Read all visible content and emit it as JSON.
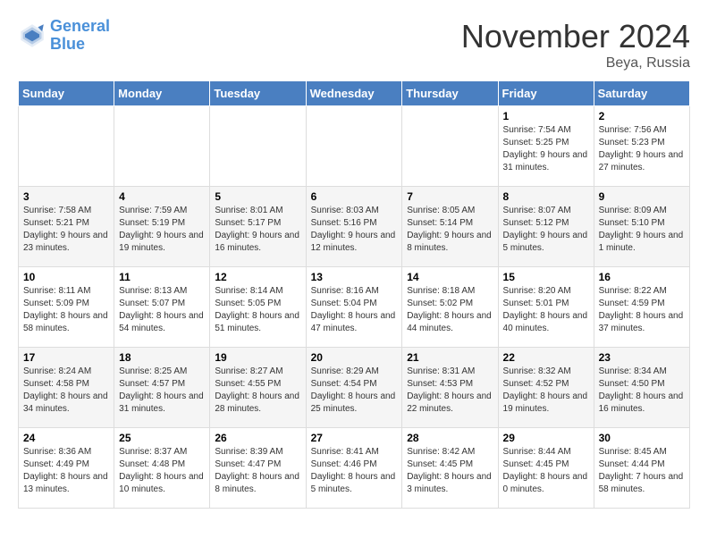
{
  "logo": {
    "line1": "General",
    "line2": "Blue"
  },
  "title": "November 2024",
  "location": "Beya, Russia",
  "days_header": [
    "Sunday",
    "Monday",
    "Tuesday",
    "Wednesday",
    "Thursday",
    "Friday",
    "Saturday"
  ],
  "weeks": [
    [
      {
        "day": "",
        "info": ""
      },
      {
        "day": "",
        "info": ""
      },
      {
        "day": "",
        "info": ""
      },
      {
        "day": "",
        "info": ""
      },
      {
        "day": "",
        "info": ""
      },
      {
        "day": "1",
        "info": "Sunrise: 7:54 AM\nSunset: 5:25 PM\nDaylight: 9 hours and 31 minutes."
      },
      {
        "day": "2",
        "info": "Sunrise: 7:56 AM\nSunset: 5:23 PM\nDaylight: 9 hours and 27 minutes."
      }
    ],
    [
      {
        "day": "3",
        "info": "Sunrise: 7:58 AM\nSunset: 5:21 PM\nDaylight: 9 hours and 23 minutes."
      },
      {
        "day": "4",
        "info": "Sunrise: 7:59 AM\nSunset: 5:19 PM\nDaylight: 9 hours and 19 minutes."
      },
      {
        "day": "5",
        "info": "Sunrise: 8:01 AM\nSunset: 5:17 PM\nDaylight: 9 hours and 16 minutes."
      },
      {
        "day": "6",
        "info": "Sunrise: 8:03 AM\nSunset: 5:16 PM\nDaylight: 9 hours and 12 minutes."
      },
      {
        "day": "7",
        "info": "Sunrise: 8:05 AM\nSunset: 5:14 PM\nDaylight: 9 hours and 8 minutes."
      },
      {
        "day": "8",
        "info": "Sunrise: 8:07 AM\nSunset: 5:12 PM\nDaylight: 9 hours and 5 minutes."
      },
      {
        "day": "9",
        "info": "Sunrise: 8:09 AM\nSunset: 5:10 PM\nDaylight: 9 hours and 1 minute."
      }
    ],
    [
      {
        "day": "10",
        "info": "Sunrise: 8:11 AM\nSunset: 5:09 PM\nDaylight: 8 hours and 58 minutes."
      },
      {
        "day": "11",
        "info": "Sunrise: 8:13 AM\nSunset: 5:07 PM\nDaylight: 8 hours and 54 minutes."
      },
      {
        "day": "12",
        "info": "Sunrise: 8:14 AM\nSunset: 5:05 PM\nDaylight: 8 hours and 51 minutes."
      },
      {
        "day": "13",
        "info": "Sunrise: 8:16 AM\nSunset: 5:04 PM\nDaylight: 8 hours and 47 minutes."
      },
      {
        "day": "14",
        "info": "Sunrise: 8:18 AM\nSunset: 5:02 PM\nDaylight: 8 hours and 44 minutes."
      },
      {
        "day": "15",
        "info": "Sunrise: 8:20 AM\nSunset: 5:01 PM\nDaylight: 8 hours and 40 minutes."
      },
      {
        "day": "16",
        "info": "Sunrise: 8:22 AM\nSunset: 4:59 PM\nDaylight: 8 hours and 37 minutes."
      }
    ],
    [
      {
        "day": "17",
        "info": "Sunrise: 8:24 AM\nSunset: 4:58 PM\nDaylight: 8 hours and 34 minutes."
      },
      {
        "day": "18",
        "info": "Sunrise: 8:25 AM\nSunset: 4:57 PM\nDaylight: 8 hours and 31 minutes."
      },
      {
        "day": "19",
        "info": "Sunrise: 8:27 AM\nSunset: 4:55 PM\nDaylight: 8 hours and 28 minutes."
      },
      {
        "day": "20",
        "info": "Sunrise: 8:29 AM\nSunset: 4:54 PM\nDaylight: 8 hours and 25 minutes."
      },
      {
        "day": "21",
        "info": "Sunrise: 8:31 AM\nSunset: 4:53 PM\nDaylight: 8 hours and 22 minutes."
      },
      {
        "day": "22",
        "info": "Sunrise: 8:32 AM\nSunset: 4:52 PM\nDaylight: 8 hours and 19 minutes."
      },
      {
        "day": "23",
        "info": "Sunrise: 8:34 AM\nSunset: 4:50 PM\nDaylight: 8 hours and 16 minutes."
      }
    ],
    [
      {
        "day": "24",
        "info": "Sunrise: 8:36 AM\nSunset: 4:49 PM\nDaylight: 8 hours and 13 minutes."
      },
      {
        "day": "25",
        "info": "Sunrise: 8:37 AM\nSunset: 4:48 PM\nDaylight: 8 hours and 10 minutes."
      },
      {
        "day": "26",
        "info": "Sunrise: 8:39 AM\nSunset: 4:47 PM\nDaylight: 8 hours and 8 minutes."
      },
      {
        "day": "27",
        "info": "Sunrise: 8:41 AM\nSunset: 4:46 PM\nDaylight: 8 hours and 5 minutes."
      },
      {
        "day": "28",
        "info": "Sunrise: 8:42 AM\nSunset: 4:45 PM\nDaylight: 8 hours and 3 minutes."
      },
      {
        "day": "29",
        "info": "Sunrise: 8:44 AM\nSunset: 4:45 PM\nDaylight: 8 hours and 0 minutes."
      },
      {
        "day": "30",
        "info": "Sunrise: 8:45 AM\nSunset: 4:44 PM\nDaylight: 7 hours and 58 minutes."
      }
    ]
  ]
}
